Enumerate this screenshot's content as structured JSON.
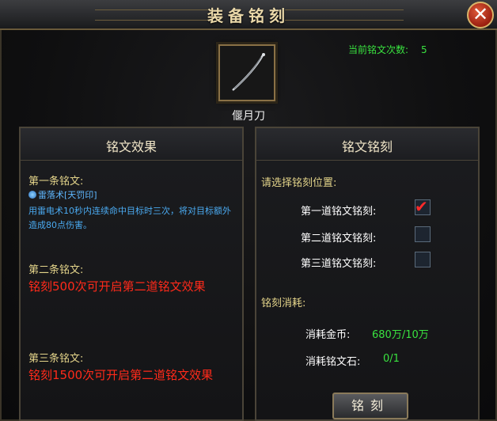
{
  "window": {
    "title": "装备铭刻",
    "close_label": "✕"
  },
  "count": {
    "label": "当前铭文次数:",
    "value": "5"
  },
  "weapon": {
    "name": "偃月刀"
  },
  "left_panel": {
    "title": "铭文效果",
    "first_label": "第一条铭文:",
    "first_buff_name": "雷落术[天罚印]",
    "first_buff_desc": "用雷电术10秒内连续命中目标时三次，将对目标额外造成80点伤害。",
    "second_label": "第二条铭文:",
    "second_text": "铭刻500次可开启第二道铭文效果",
    "third_label": "第三条铭文:",
    "third_text": "铭刻1500次可开启第二道铭文效果"
  },
  "right_panel": {
    "title": "铭文铭刻",
    "select_prompt": "请选择铭刻位置:",
    "slots": [
      {
        "label": "第一道铭文铭刻:",
        "checked": true
      },
      {
        "label": "第二道铭文铭刻:",
        "checked": false
      },
      {
        "label": "第三道铭文铭刻:",
        "checked": false
      }
    ],
    "cost_title": "铭刻消耗:",
    "gold_label": "消耗金币:",
    "gold_value": "680万/10万",
    "stone_label": "消耗铭文石:",
    "stone_value": "0/1",
    "button_label": "铭刻"
  },
  "colors": {
    "accent_green": "#39e23f",
    "warning_red": "#ff2a1a",
    "title_gold": "#e9d7a8"
  }
}
